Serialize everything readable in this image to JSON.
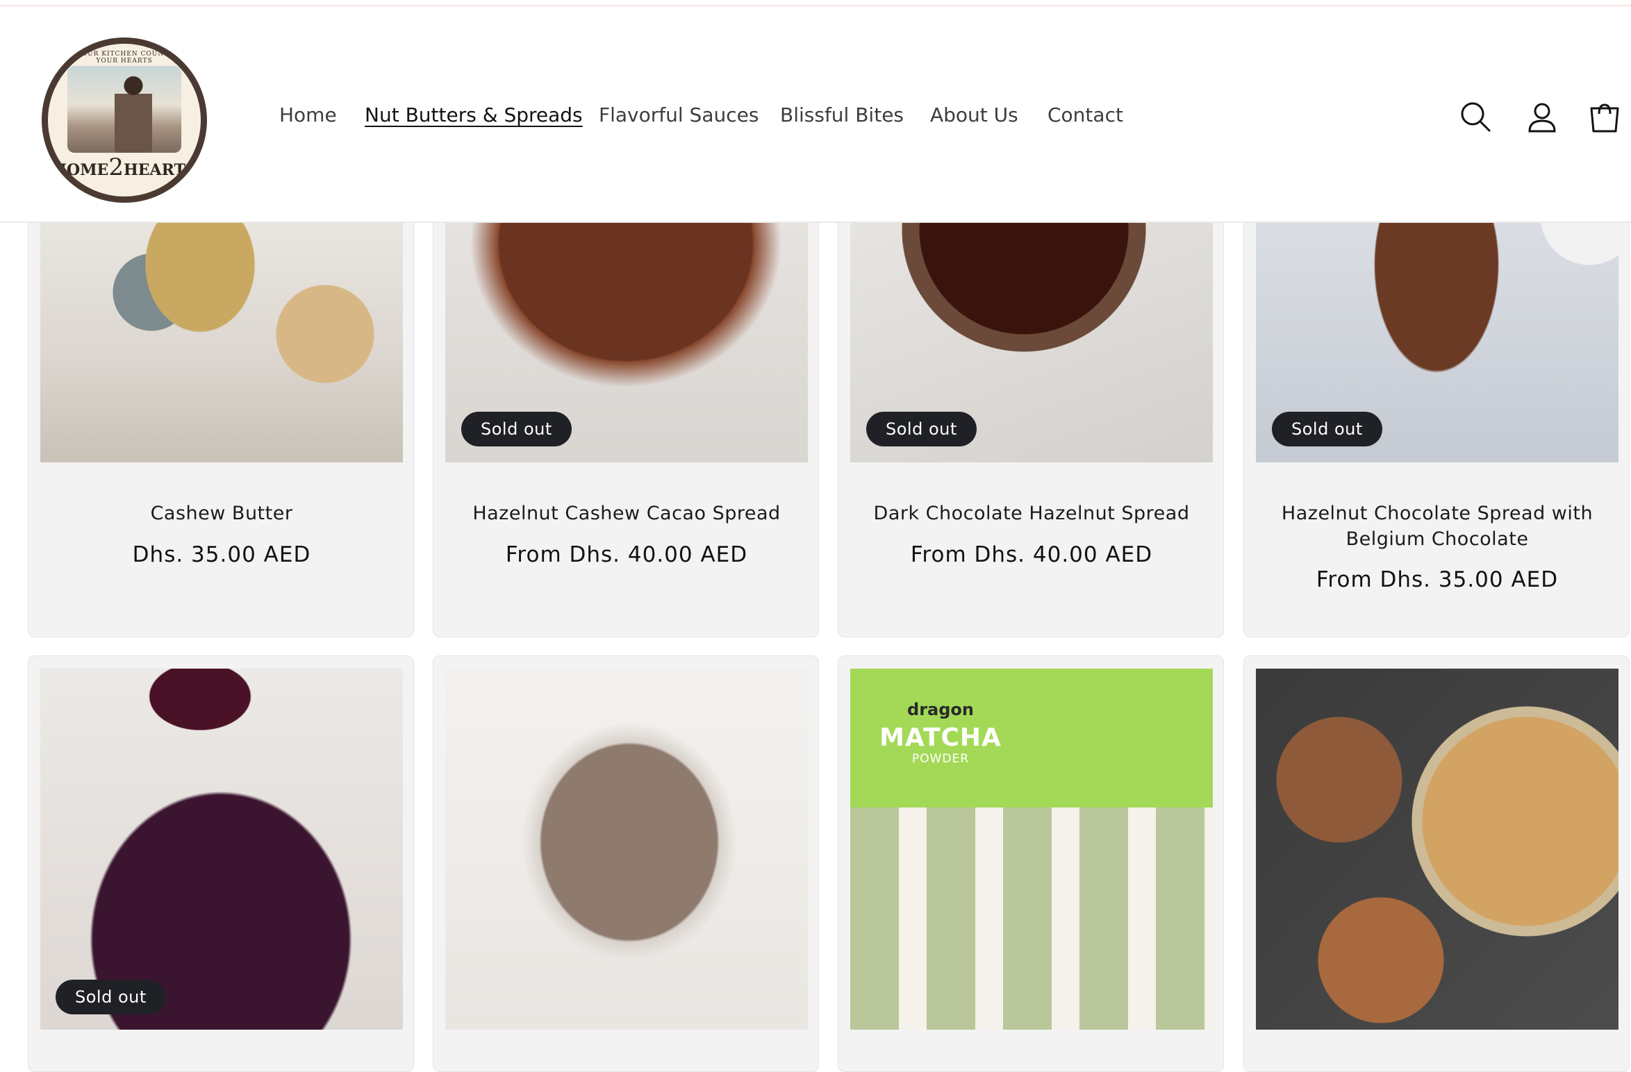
{
  "header": {
    "logo": {
      "ring_text": "FROM OUR KITCHEN COUNTER TO YOUR HEARTS",
      "wordmark_left": "HOME",
      "wordmark_number": "2",
      "wordmark_right": "HEARTS"
    },
    "nav": [
      {
        "label": "Home",
        "active": false
      },
      {
        "label": "Nut Butters & Spreads",
        "active": true
      },
      {
        "label": "Flavorful Sauces",
        "active": false
      },
      {
        "label": "Blissful Bites",
        "active": false
      },
      {
        "label": "About Us",
        "active": false
      },
      {
        "label": "Contact",
        "active": false
      }
    ],
    "icons": [
      "search-icon",
      "account-icon",
      "cart-icon"
    ]
  },
  "products": [
    {
      "title": "Cashew Butter",
      "price": "Dhs. 35.00 AED",
      "sold_out": false
    },
    {
      "title": "Hazelnut Cashew Cacao Spread",
      "price": "From Dhs. 40.00 AED",
      "sold_out": true
    },
    {
      "title": "Dark Chocolate Hazelnut Spread",
      "price": "From Dhs. 40.00 AED",
      "sold_out": true
    },
    {
      "title": "Hazelnut Chocolate Spread with Belgium Chocolate",
      "price": "From Dhs. 35.00 AED",
      "sold_out": true
    },
    {
      "title": "",
      "price": "",
      "sold_out": true
    },
    {
      "title": "",
      "price": "",
      "sold_out": false
    },
    {
      "title": "",
      "price": "",
      "sold_out": false
    },
    {
      "title": "",
      "price": "",
      "sold_out": false
    }
  ],
  "badge_label": "Sold out",
  "matcha_pack": {
    "brand": "dragon",
    "word": "MATCHA",
    "sub": "POWDER"
  }
}
